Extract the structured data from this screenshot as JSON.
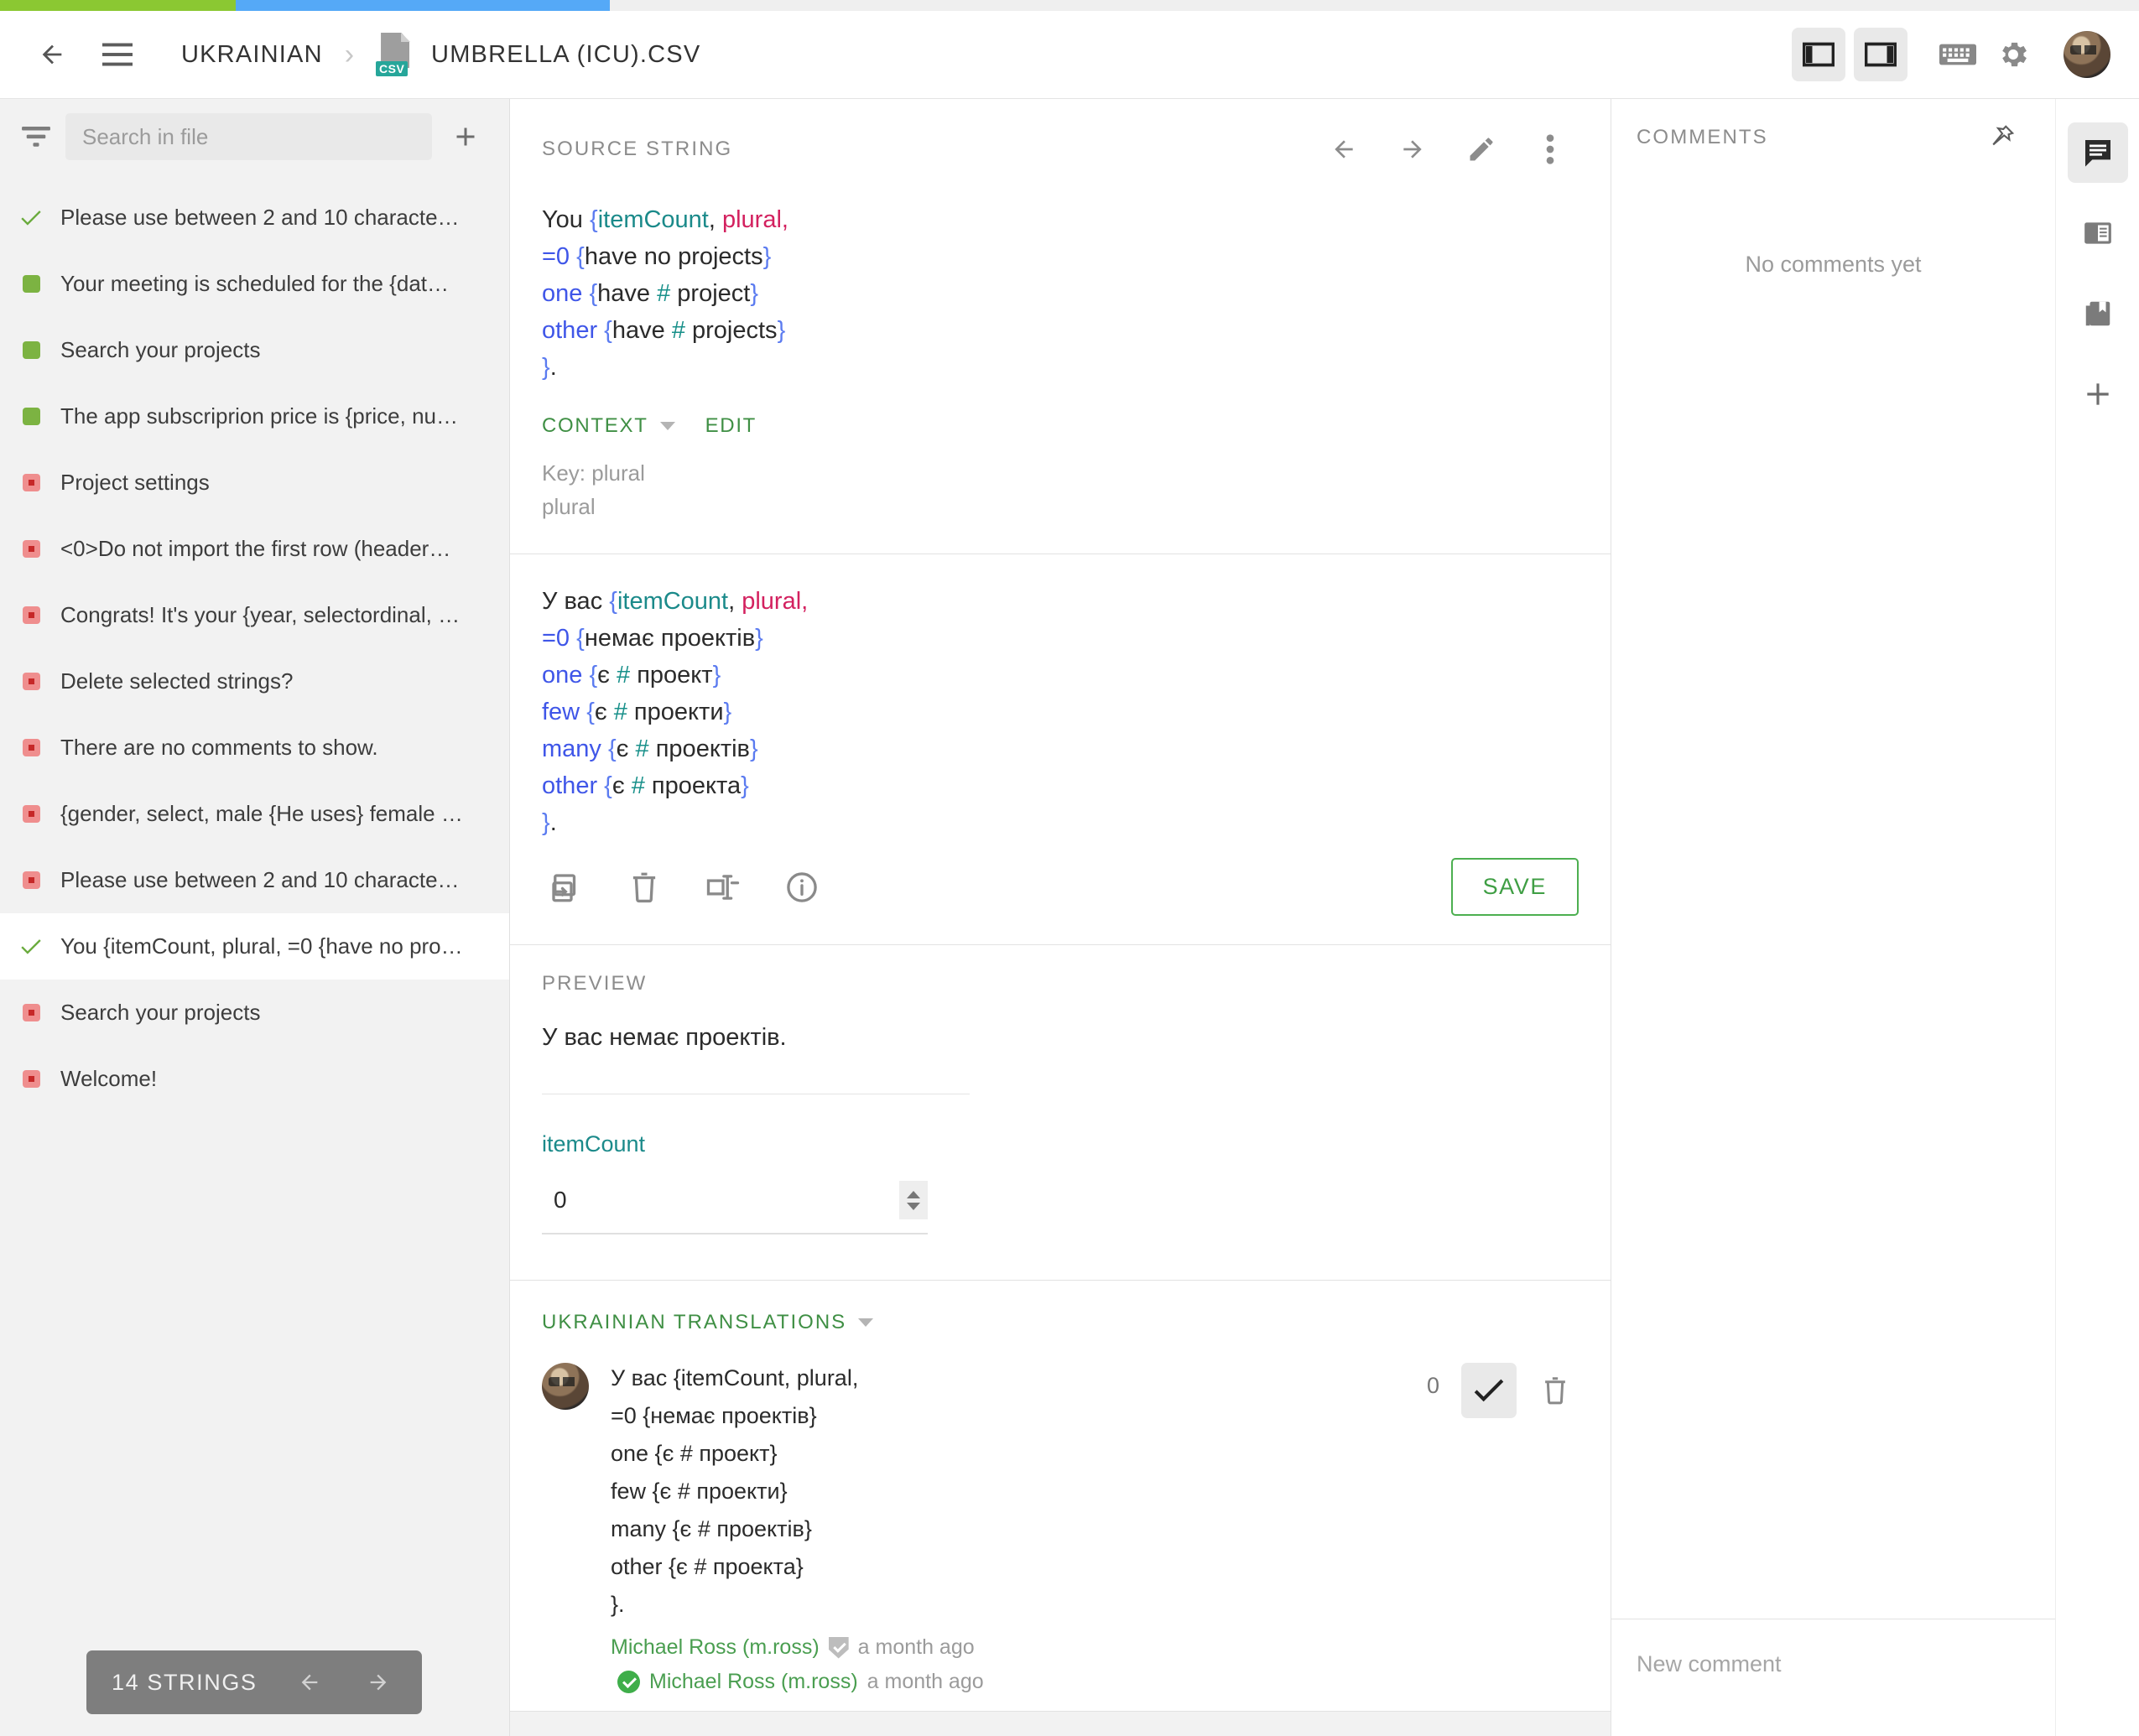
{
  "progress": {
    "green_pct": 11,
    "blue_pct": 17.5,
    "grey_pct": 71.5,
    "green_color": "#8bc832",
    "blue_color": "#55a9f7",
    "grey_color": "#efefef"
  },
  "topbar": {
    "back_icon": "arrow-left-icon",
    "menu_icon": "hamburger-menu-icon",
    "breadcrumb_language": "UKRAINIAN",
    "breadcrumb_separator": "›",
    "file_badge": "CSV",
    "breadcrumb_file": "UMBRELLA (ICU).CSV",
    "left_panel_toggle": "layout-left-panel-icon",
    "right_panel_toggle": "layout-right-panel-icon",
    "keyboard_icon": "keyboard-icon",
    "settings_icon": "gear-icon",
    "avatar": "user-avatar"
  },
  "sidebar": {
    "filter_icon": "filter-icon",
    "search_placeholder": "Search in file",
    "search_value": "",
    "add_icon": "plus-icon",
    "items": [
      {
        "status": "approved",
        "label": "Please use between 2 and 10 characte…",
        "selected": false
      },
      {
        "status": "translated",
        "label": "Your meeting is scheduled for the {dat…",
        "selected": false
      },
      {
        "status": "translated",
        "label": "Search your projects",
        "selected": false
      },
      {
        "status": "translated",
        "label": "The app subscriprion price is {price, nu…",
        "selected": false
      },
      {
        "status": "untranslated",
        "label": "Project settings",
        "selected": false
      },
      {
        "status": "untranslated",
        "label": "<0>Do not import the first row (header…",
        "selected": false
      },
      {
        "status": "untranslated",
        "label": "Congrats! It's your {year, selectordinal, …",
        "selected": false
      },
      {
        "status": "untranslated",
        "label": "Delete selected strings?",
        "selected": false
      },
      {
        "status": "untranslated",
        "label": "There are no comments to show.",
        "selected": false
      },
      {
        "status": "untranslated",
        "label": "{gender, select, male {He uses} female …",
        "selected": false
      },
      {
        "status": "untranslated",
        "label": "Please use between 2 and 10 characte…",
        "selected": false
      },
      {
        "status": "approved",
        "label": "You {itemCount, plural, =0 {have no pro…",
        "selected": true
      },
      {
        "status": "untranslated",
        "label": "Search your projects",
        "selected": false
      },
      {
        "status": "untranslated",
        "label": "Welcome!",
        "selected": false
      }
    ],
    "pager": {
      "count_label": "14 STRINGS",
      "prev_icon": "arrow-left-icon",
      "next_icon": "arrow-right-icon"
    }
  },
  "source_panel": {
    "title": "SOURCE STRING",
    "prev_icon": "arrow-left-icon",
    "next_icon": "arrow-right-icon",
    "edit_icon": "pencil-icon",
    "more_icon": "more-vertical-icon",
    "lines": [
      [
        {
          "t": "You ",
          "c": "plain"
        },
        {
          "t": "{",
          "c": "brace"
        },
        {
          "t": "itemCount",
          "c": "var"
        },
        {
          "t": ", ",
          "c": "plain"
        },
        {
          "t": "plural",
          "c": "kw"
        },
        {
          "t": ",",
          "c": "kw"
        }
      ],
      [
        {
          "t": "=0 ",
          "c": "sel"
        },
        {
          "t": "{",
          "c": "brace"
        },
        {
          "t": "have no projects",
          "c": "plain"
        },
        {
          "t": "}",
          "c": "brace"
        }
      ],
      [
        {
          "t": "one ",
          "c": "sel"
        },
        {
          "t": "{",
          "c": "brace"
        },
        {
          "t": "have ",
          "c": "plain"
        },
        {
          "t": "#",
          "c": "hash"
        },
        {
          "t": " project",
          "c": "plain"
        },
        {
          "t": "}",
          "c": "brace"
        }
      ],
      [
        {
          "t": "other ",
          "c": "sel"
        },
        {
          "t": "{",
          "c": "brace"
        },
        {
          "t": "have ",
          "c": "plain"
        },
        {
          "t": "#",
          "c": "hash"
        },
        {
          "t": " projects",
          "c": "plain"
        },
        {
          "t": "}",
          "c": "brace"
        }
      ],
      [
        {
          "t": "}",
          "c": "brace"
        },
        {
          "t": ".",
          "c": "plain"
        }
      ]
    ],
    "context_label": "CONTEXT",
    "edit_label": "EDIT",
    "context_key": "Key: plural",
    "context_note": "plural"
  },
  "target_panel": {
    "lines": [
      [
        {
          "t": "У вас ",
          "c": "plain"
        },
        {
          "t": "{",
          "c": "brace"
        },
        {
          "t": "itemCount",
          "c": "var"
        },
        {
          "t": ", ",
          "c": "plain"
        },
        {
          "t": "plural",
          "c": "kw"
        },
        {
          "t": ",",
          "c": "kw"
        }
      ],
      [
        {
          "t": "=0 ",
          "c": "sel"
        },
        {
          "t": "{",
          "c": "brace"
        },
        {
          "t": "немає проектів",
          "c": "plain"
        },
        {
          "t": "}",
          "c": "brace"
        }
      ],
      [
        {
          "t": "one ",
          "c": "sel"
        },
        {
          "t": "{",
          "c": "brace"
        },
        {
          "t": "є ",
          "c": "plain"
        },
        {
          "t": "#",
          "c": "hash"
        },
        {
          "t": " проект",
          "c": "plain"
        },
        {
          "t": "}",
          "c": "brace"
        }
      ],
      [
        {
          "t": "few ",
          "c": "sel"
        },
        {
          "t": "{",
          "c": "brace"
        },
        {
          "t": "є ",
          "c": "plain"
        },
        {
          "t": "#",
          "c": "hash"
        },
        {
          "t": " проекти",
          "c": "plain"
        },
        {
          "t": "}",
          "c": "brace"
        }
      ],
      [
        {
          "t": "many ",
          "c": "sel"
        },
        {
          "t": "{",
          "c": "brace"
        },
        {
          "t": "є ",
          "c": "plain"
        },
        {
          "t": "#",
          "c": "hash"
        },
        {
          "t": " проектів",
          "c": "plain"
        },
        {
          "t": "}",
          "c": "brace"
        }
      ],
      [
        {
          "t": "other ",
          "c": "sel"
        },
        {
          "t": "{",
          "c": "brace"
        },
        {
          "t": "є ",
          "c": "plain"
        },
        {
          "t": "#",
          "c": "hash"
        },
        {
          "t": " проекта",
          "c": "plain"
        },
        {
          "t": "}",
          "c": "brace"
        }
      ],
      [
        {
          "t": "}",
          "c": "brace"
        },
        {
          "t": ".",
          "c": "plain"
        }
      ]
    ],
    "copy_icon": "copy-source-icon",
    "clear_icon": "trash-icon",
    "placeholder_icon": "insert-placeholder-icon",
    "info_icon": "info-icon",
    "save_label": "SAVE"
  },
  "preview_panel": {
    "title": "PREVIEW",
    "rendered": "У вас немає проектів.",
    "param_name": "itemCount",
    "param_value": "0"
  },
  "translations_panel": {
    "title": "UKRAINIAN TRANSLATIONS",
    "entry": {
      "text": "У вас {itemCount, plural,\n=0 {немає проектів}\none {є # проект}\nfew {є # проекти}\nmany {є # проектів}\nother {є # проекта}\n}.",
      "author": "Michael Ross (m.ross)",
      "time": "a month ago",
      "approver": "Michael Ross (m.ross)",
      "approve_time": "a month ago",
      "vote_count": "0",
      "approve_icon": "check-icon",
      "delete_icon": "trash-icon"
    }
  },
  "comments_panel": {
    "title": "COMMENTS",
    "pin_icon": "pin-icon",
    "empty_text": "No comments yet",
    "new_comment_placeholder": "New comment"
  },
  "rail": {
    "items": [
      {
        "icon": "comment-icon",
        "active": true
      },
      {
        "icon": "reference-panel-icon",
        "active": false
      },
      {
        "icon": "glossary-bookmark-icon",
        "active": false
      },
      {
        "icon": "plus-icon",
        "active": false
      }
    ]
  },
  "colors": {
    "accent_green": "#3f8f44",
    "save_green": "#4caf50",
    "var_teal": "#1b8a8a",
    "keyword_pink": "#d3215f",
    "selector_blue": "#3f56e8",
    "brace_blue": "#5b7bf0"
  }
}
